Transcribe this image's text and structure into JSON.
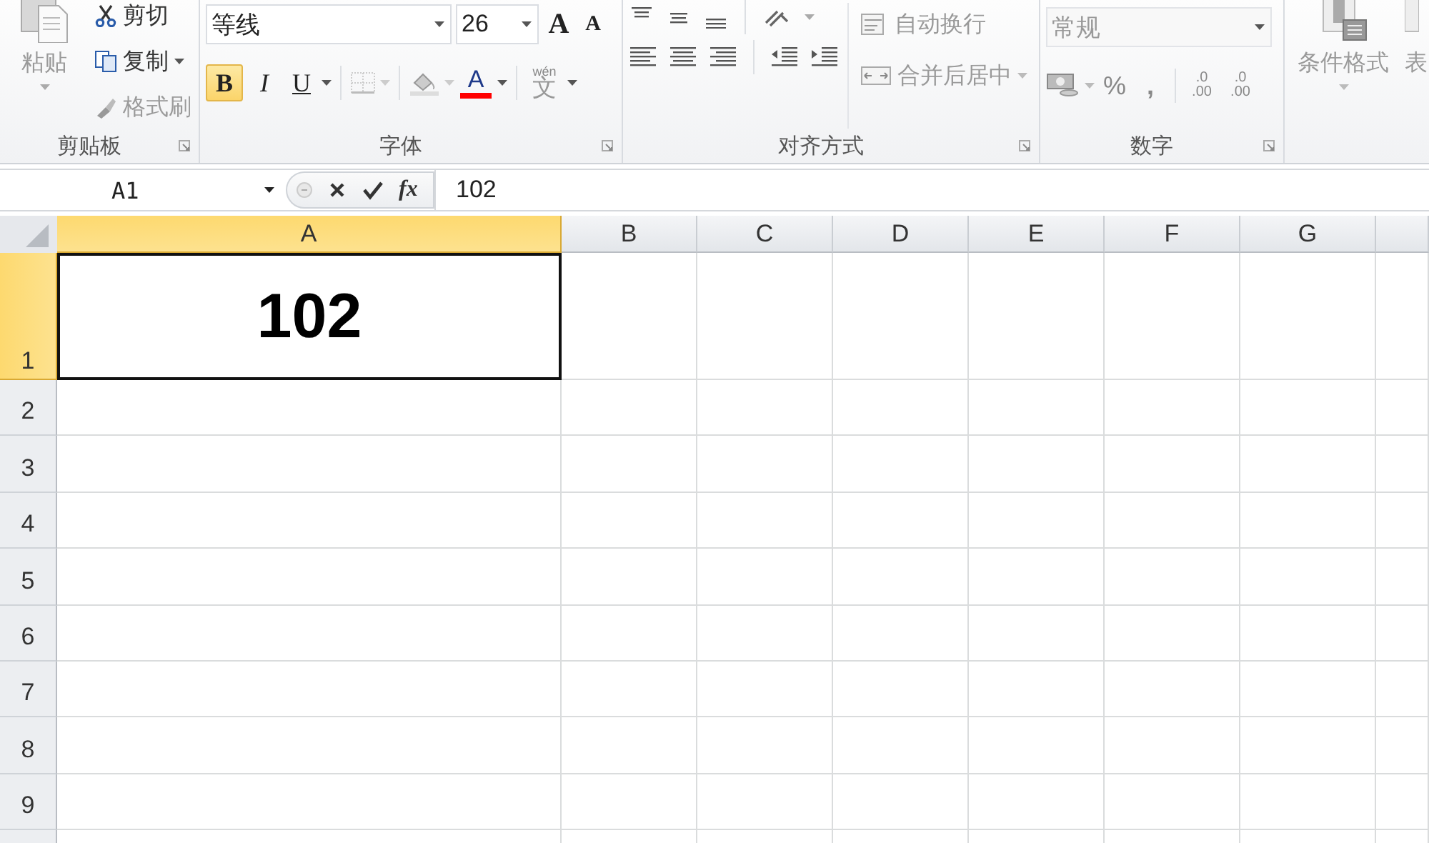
{
  "clipboard": {
    "paste": {
      "label": "粘贴",
      "disabled": true
    },
    "cut": {
      "label": "剪切",
      "disabled": false
    },
    "copy": {
      "label": "复制",
      "disabled": false
    },
    "format_painter": {
      "label": "格式刷",
      "disabled": true
    },
    "group_label": "剪贴板"
  },
  "font": {
    "font_name": "等线",
    "font_size": "26",
    "grow_font": "A",
    "shrink_font": "A",
    "bold": {
      "label": "B",
      "selected": true
    },
    "italic": {
      "label": "I",
      "selected": false
    },
    "underline": {
      "label": "U",
      "selected": false
    },
    "font_color": {
      "label": "A",
      "color": "#ff0000"
    },
    "phonetic": {
      "ruby": "wén",
      "char": "文"
    },
    "group_label": "字体"
  },
  "alignment": {
    "wrap_text": {
      "label": "自动换行",
      "disabled": true
    },
    "merge_center": {
      "label": "合并后居中",
      "disabled": true
    },
    "group_label": "对齐方式"
  },
  "number": {
    "format": {
      "value": "常规",
      "disabled": true
    },
    "percent": "%",
    "comma": ",",
    "increase_decimal": {
      "top": ".0",
      "bottom": ".00"
    },
    "decrease_decimal": {
      "top": ".0",
      "bottom": ".00"
    },
    "group_label": "数字"
  },
  "styles": {
    "conditional_formatting": {
      "label": "条件格式",
      "disabled": true
    },
    "table_format": {
      "label": "表",
      "disabled": true
    }
  },
  "formula_bar": {
    "name_box": "A1",
    "function_label": "fx",
    "content": "102"
  },
  "columns": [
    {
      "label": "A",
      "selected": true
    },
    {
      "label": "B",
      "selected": false
    },
    {
      "label": "C",
      "selected": false
    },
    {
      "label": "D",
      "selected": false
    },
    {
      "label": "E",
      "selected": false
    },
    {
      "label": "F",
      "selected": false
    },
    {
      "label": "G",
      "selected": false
    }
  ],
  "rows": [
    {
      "label": "1",
      "selected": true,
      "cells": [
        {
          "value": "102",
          "selected": true
        }
      ]
    },
    {
      "label": "2",
      "selected": false
    },
    {
      "label": "3",
      "selected": false
    },
    {
      "label": "4",
      "selected": false
    },
    {
      "label": "5",
      "selected": false
    },
    {
      "label": "6",
      "selected": false
    },
    {
      "label": "7",
      "selected": false
    },
    {
      "label": "8",
      "selected": false
    },
    {
      "label": "9",
      "selected": false
    }
  ]
}
